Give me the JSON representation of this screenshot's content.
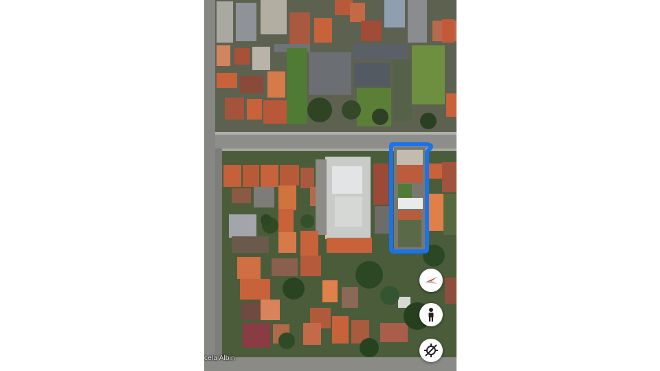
{
  "map": {
    "view": "satellite",
    "street_label": "cela Albin",
    "highlight_color": "#1a73e8",
    "highlight_shape": "rounded-rectangle outline around a narrow lot"
  },
  "controls": [
    {
      "name": "compass-button",
      "icon": "compass-icon"
    },
    {
      "name": "street-view-button",
      "icon": "pegman-icon"
    },
    {
      "name": "location-button",
      "icon": "location-disabled-icon"
    }
  ],
  "colors": {
    "roof_orange": "#c8623a",
    "roof_gray": "#6f7378",
    "vegetation": "#3f5a2e",
    "road": "#8d8d8a"
  }
}
